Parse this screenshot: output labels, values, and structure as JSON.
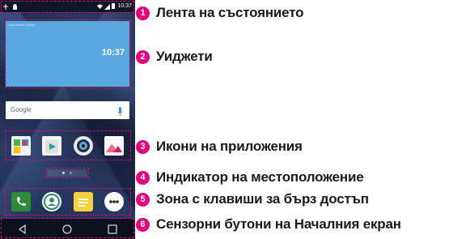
{
  "screen": {
    "status_time": "10:37",
    "widget_small_text": "Lock screen photo",
    "widget_time": "10:37",
    "search_brand": "Google"
  },
  "callouts": [
    {
      "number": "1",
      "label": "Лента на състоянието"
    },
    {
      "number": "2",
      "label": "Уиджети"
    },
    {
      "number": "3",
      "label": "Икони на приложения"
    },
    {
      "number": "4",
      "label": "Индикатор на местоположение"
    },
    {
      "number": "5",
      "label": "Зона с клавиши за бърз достъп"
    },
    {
      "number": "6",
      "label": "Сензорни бутони на Началния екран"
    }
  ],
  "colors": {
    "accent": "#e6007e",
    "widget": "#5aa8e0",
    "phone_app": "#2e8a3a",
    "messages": "#f6d33c"
  }
}
